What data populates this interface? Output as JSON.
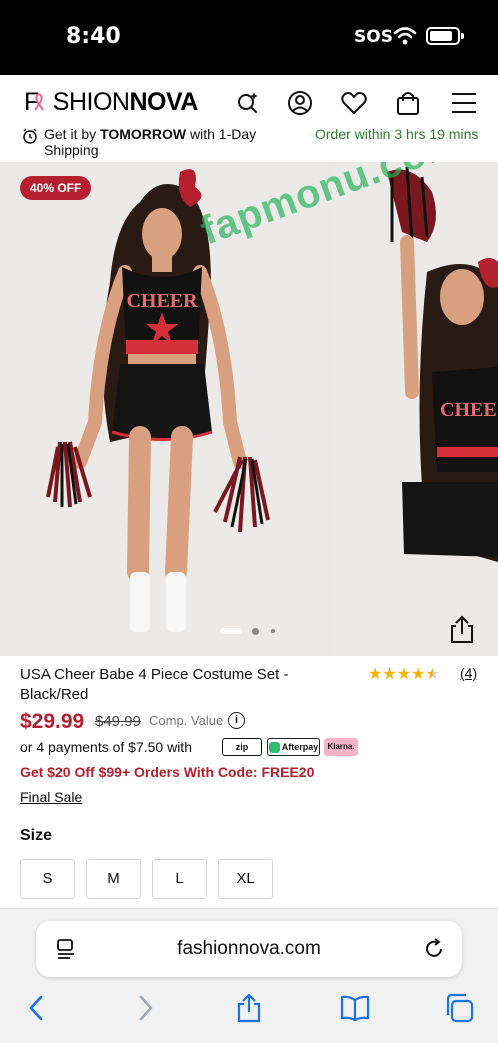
{
  "status": {
    "time": "8:40",
    "carrier": "SOS"
  },
  "header": {
    "logo_left": "F",
    "logo_mid": "SHION",
    "logo_bold": "NOVA"
  },
  "delivery": {
    "prefix": "Get it by ",
    "highlight": "TOMORROW",
    "suffix": " with 1-Day Shipping",
    "countdown": "Order within 3 hrs 19 mins"
  },
  "gallery": {
    "badge": "40% OFF",
    "watermark": "fapmonu.com",
    "slides": 3,
    "active_slide": 1
  },
  "product": {
    "title": "USA Cheer Babe 4 Piece Costume Set - Black/Red",
    "rating": 4.5,
    "review_count": "(4)",
    "price": "$29.99",
    "compare_price": "$49.99",
    "compare_label": "Comp. Value",
    "installments": "or 4 payments of $7.50 with",
    "pay_options": [
      "zip",
      "Afterpay",
      "Klarna."
    ],
    "promo": "Get $20 Off $99+ Orders With Code: FREE20",
    "final_sale": "Final Sale",
    "size_label": "Size",
    "sizes": [
      "S",
      "M",
      "L",
      "XL"
    ]
  },
  "browser": {
    "url": "fashionnova.com"
  },
  "colors": {
    "accent": "#b5202e",
    "success": "#2e7d32",
    "star": "#f5b400"
  }
}
